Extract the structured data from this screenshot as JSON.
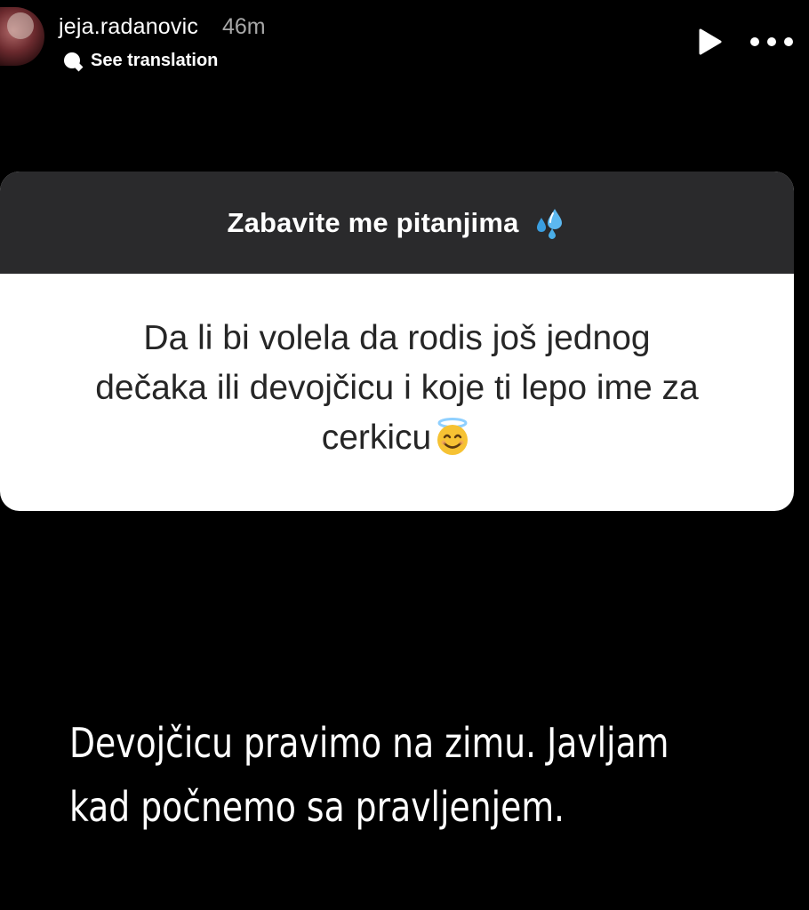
{
  "story_header": {
    "username": "jeja.radanovic",
    "timestamp": "46m",
    "see_translation_label": "See translation",
    "play_icon": "play-icon",
    "more_icon": "more-horizontal-icon"
  },
  "question_sticker": {
    "title": "Zabavite me pitanjima",
    "title_emoji": "sweat-droplets-icon",
    "question_lines": [
      "Da li bi volela da rodis još jednog",
      "dečaka ili devojčicu i koje ti lepo ime za",
      "cerkicu"
    ],
    "question_emoji": "smiling-face-with-halo-icon",
    "header_color": "#2a2a2c",
    "body_color": "#ffffff"
  },
  "answer": {
    "lines": [
      "Devojčicu pravimo na zimu. Javljam",
      "kad počnemo sa pravljenjem."
    ]
  },
  "colors": {
    "background": "#000000",
    "text_primary": "#ffffff",
    "text_secondary": "#a8a8a8",
    "question_text": "#262626"
  }
}
